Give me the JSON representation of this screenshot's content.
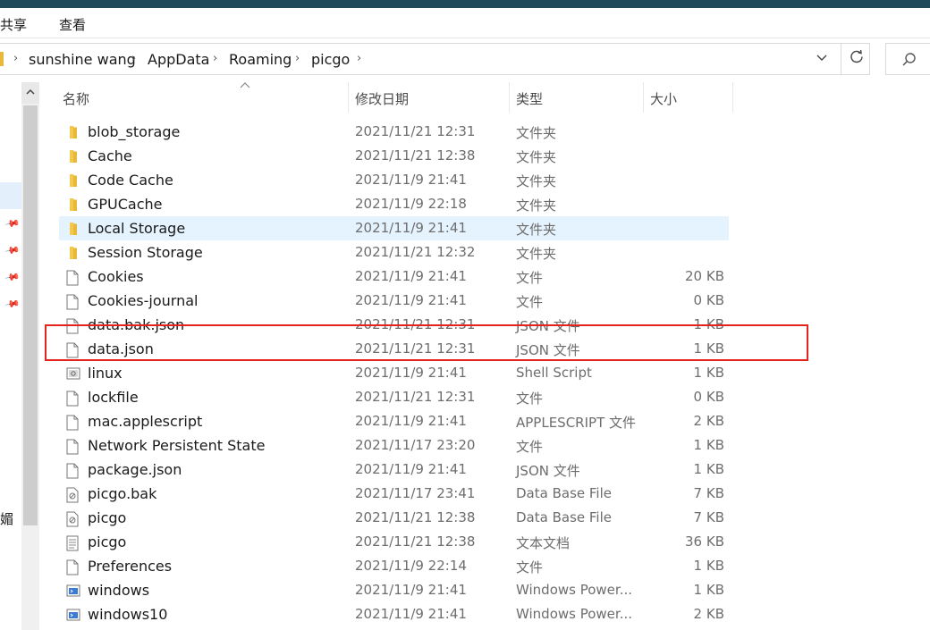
{
  "ribbon": {
    "tabs": [
      "共享",
      "查看"
    ]
  },
  "address": {
    "crumbs": [
      "sunshine wang",
      "AppData",
      "Roaming",
      "picgo"
    ],
    "separator": "›"
  },
  "nav": {
    "fragment": "媚"
  },
  "columns": {
    "name": "名称",
    "modified": "修改日期",
    "type": "类型",
    "size": "大小"
  },
  "colors": {
    "folder": "#e8b83a",
    "highlight": "#e3231c",
    "hover": "#e5f3ff"
  },
  "files": [
    {
      "name": "blob_storage",
      "modified": "2021/11/21 12:31",
      "type": "文件夹",
      "size": "",
      "icon": "folder-icon"
    },
    {
      "name": "Cache",
      "modified": "2021/11/21 12:38",
      "type": "文件夹",
      "size": "",
      "icon": "folder-icon"
    },
    {
      "name": "Code Cache",
      "modified": "2021/11/9 21:41",
      "type": "文件夹",
      "size": "",
      "icon": "folder-icon"
    },
    {
      "name": "GPUCache",
      "modified": "2021/11/9 22:18",
      "type": "文件夹",
      "size": "",
      "icon": "folder-icon"
    },
    {
      "name": "Local Storage",
      "modified": "2021/11/9 21:41",
      "type": "文件夹",
      "size": "",
      "icon": "folder-icon"
    },
    {
      "name": "Session Storage",
      "modified": "2021/11/21 12:32",
      "type": "文件夹",
      "size": "",
      "icon": "folder-icon"
    },
    {
      "name": "Cookies",
      "modified": "2021/11/9 21:41",
      "type": "文件",
      "size": "20 KB",
      "icon": "file-icon"
    },
    {
      "name": "Cookies-journal",
      "modified": "2021/11/9 21:41",
      "type": "文件",
      "size": "0 KB",
      "icon": "file-icon"
    },
    {
      "name": "data.bak.json",
      "modified": "2021/11/21 12:31",
      "type": "JSON 文件",
      "size": "1 KB",
      "icon": "file-icon"
    },
    {
      "name": "data.json",
      "modified": "2021/11/21 12:31",
      "type": "JSON 文件",
      "size": "1 KB",
      "icon": "file-icon"
    },
    {
      "name": "linux",
      "modified": "2021/11/9 21:41",
      "type": "Shell Script",
      "size": "1 KB",
      "icon": "script-file-icon"
    },
    {
      "name": "lockfile",
      "modified": "2021/11/21 12:31",
      "type": "文件",
      "size": "0 KB",
      "icon": "file-icon"
    },
    {
      "name": "mac.applescript",
      "modified": "2021/11/9 21:41",
      "type": "APPLESCRIPT 文件",
      "size": "2 KB",
      "icon": "file-icon"
    },
    {
      "name": "Network Persistent State",
      "modified": "2021/11/17 23:20",
      "type": "文件",
      "size": "1 KB",
      "icon": "file-icon"
    },
    {
      "name": "package.json",
      "modified": "2021/11/9 21:41",
      "type": "JSON 文件",
      "size": "1 KB",
      "icon": "file-icon"
    },
    {
      "name": "picgo.bak",
      "modified": "2021/11/17 23:41",
      "type": "Data Base File",
      "size": "7 KB",
      "icon": "database-file-icon"
    },
    {
      "name": "picgo",
      "modified": "2021/11/21 12:38",
      "type": "Data Base File",
      "size": "7 KB",
      "icon": "database-file-icon"
    },
    {
      "name": "picgo",
      "modified": "2021/11/21 12:38",
      "type": "文本文档",
      "size": "36 KB",
      "icon": "text-file-icon"
    },
    {
      "name": "Preferences",
      "modified": "2021/11/9 22:14",
      "type": "文件",
      "size": "1 KB",
      "icon": "file-icon"
    },
    {
      "name": "windows",
      "modified": "2021/11/9 21:41",
      "type": "Windows Power...",
      "size": "1 KB",
      "icon": "powershell-file-icon"
    },
    {
      "name": "windows10",
      "modified": "2021/11/9 21:41",
      "type": "Windows Power...",
      "size": "2 KB",
      "icon": "powershell-file-icon"
    }
  ]
}
